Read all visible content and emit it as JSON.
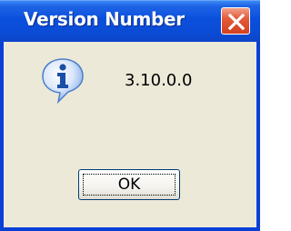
{
  "window": {
    "title": "Version Number",
    "close_icon": "close-icon",
    "titlebar_color": "#0a4fdc",
    "close_color": "#d2411f"
  },
  "dialog": {
    "icon": "info-icon",
    "message": "3.10.0.0",
    "ok_label": "OK"
  }
}
